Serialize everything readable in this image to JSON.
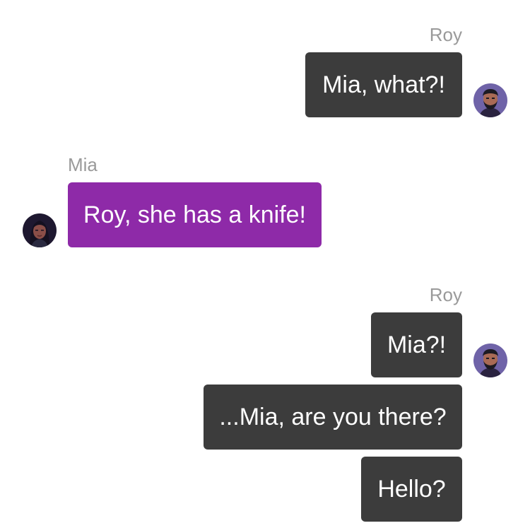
{
  "messages": [
    {
      "sender": "Roy",
      "side": "right",
      "bubbles": [
        "Mia, what?!"
      ]
    },
    {
      "sender": "Mia",
      "side": "left",
      "bubbles": [
        "Roy, she has a knife!"
      ]
    },
    {
      "sender": "Roy",
      "side": "right",
      "bubbles": [
        "Mia?!",
        "...Mia, are you there?",
        "Hello?"
      ]
    }
  ],
  "colors": {
    "roy_bubble": "#3c3c3c",
    "mia_bubble": "#8e2aa8",
    "sender_name": "#9a9a9a",
    "bubble_text": "#ffffff"
  },
  "avatars": {
    "roy": "roy-avatar-icon",
    "mia": "mia-avatar-icon"
  }
}
